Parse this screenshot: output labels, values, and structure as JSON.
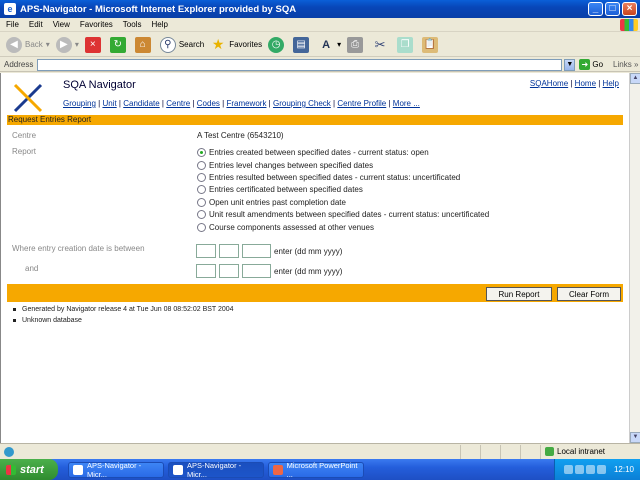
{
  "window": {
    "title": "APS-Navigator - Microsoft Internet Explorer provided by SQA"
  },
  "menu": [
    "File",
    "Edit",
    "View",
    "Favorites",
    "Tools",
    "Help"
  ],
  "toolbar": {
    "back": "Back",
    "search": "Search",
    "favorites": "Favorites"
  },
  "address": {
    "label": "Address",
    "value": "",
    "go": "Go",
    "links": "Links"
  },
  "site": {
    "brand": "SQA Navigator",
    "topnav": [
      "SQAHome",
      "Home",
      "Help"
    ],
    "nav": [
      "Grouping",
      "Unit",
      "Candidate",
      "Centre",
      "Codes",
      "Framework",
      "Grouping Check",
      "Centre Profile",
      "More ..."
    ]
  },
  "report": {
    "header": "Request Entries Report",
    "centre_label": "Centre",
    "centre_value": "A Test Centre (6543210)",
    "report_label": "Report",
    "options": [
      "Entries created between specified dates - current status: open",
      "Entries level changes between specified dates",
      "Entries resulted between specified dates - current status: uncertificated",
      "Entries certificated between specified dates",
      "Open unit entries past completion date",
      "Unit result amendments between specified dates - current status: uncertificated",
      "Course components assessed at other venues"
    ],
    "selected_index": 0,
    "date_from_label": "Where entry creation date is between",
    "date_to_label": "and",
    "date_hint": "enter (dd mm yyyy)",
    "run_button": "Run Report",
    "clear_button": "Clear Form"
  },
  "footer": [
    "Generated by Navigator release 4 at Tue Jun 08 08:52:02 BST 2004",
    "Unknown database"
  ],
  "status": {
    "zone": "Local intranet"
  },
  "taskbar": {
    "start": "start",
    "tasks": [
      "APS-Navigator - Micr...",
      "APS-Navigator - Micr...",
      "Microsoft PowerPoint ..."
    ],
    "clock": "12:10"
  }
}
